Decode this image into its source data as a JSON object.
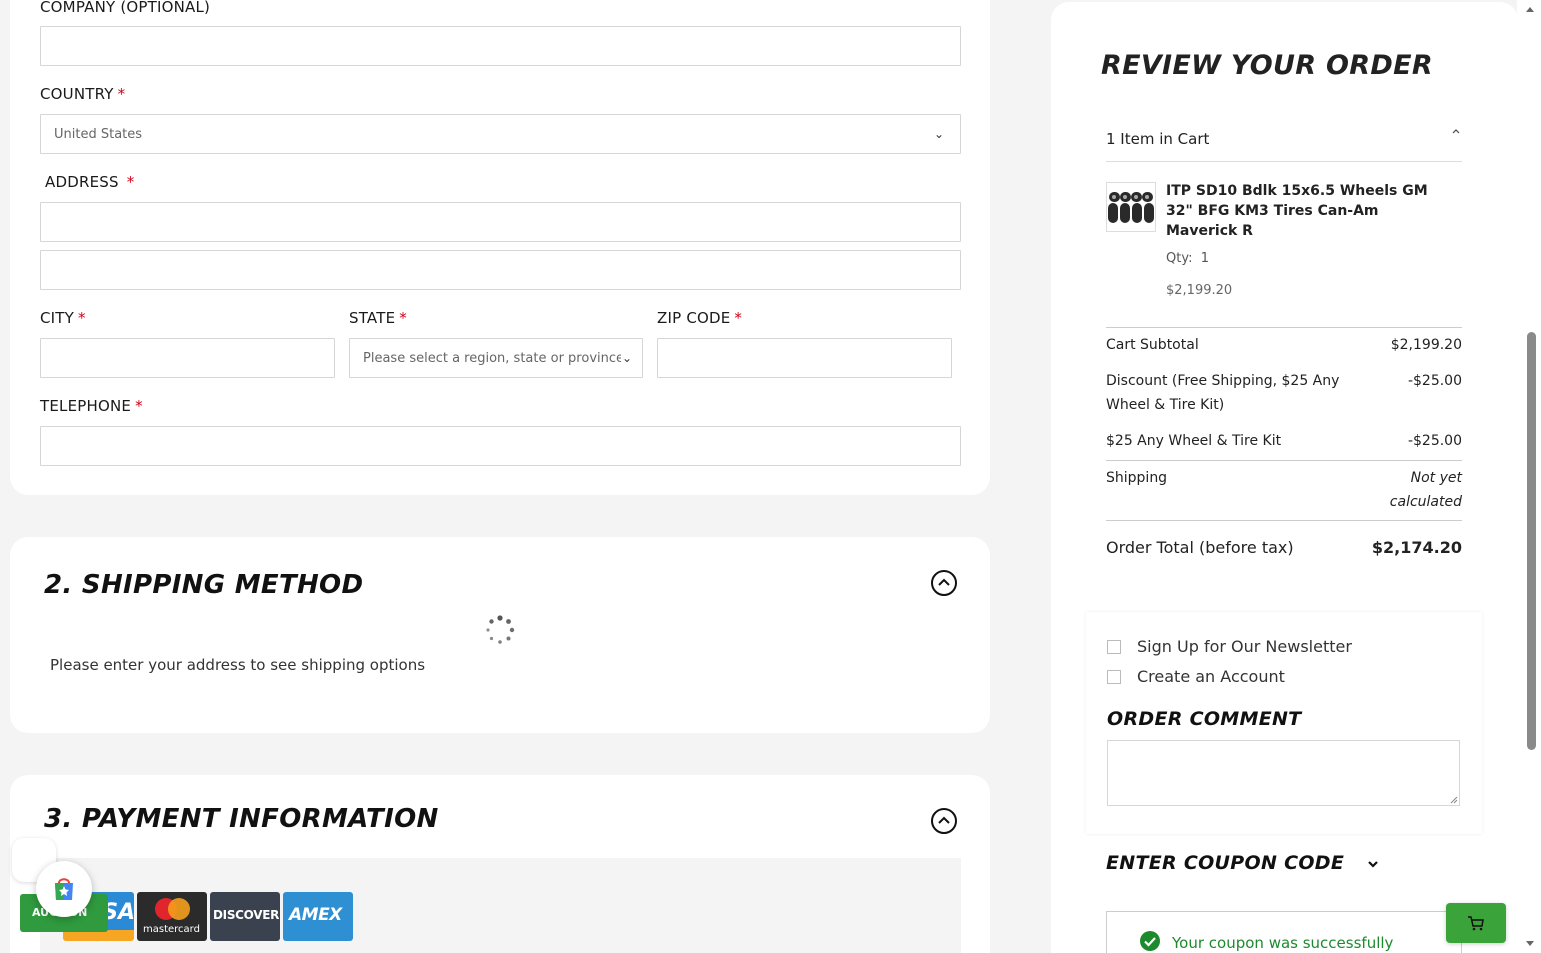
{
  "shipping_form": {
    "company_label": "COMPANY (OPTIONAL)",
    "country_label": "COUNTRY",
    "country_value": "United States",
    "address_label": "ADDRESS",
    "city_label": "CITY",
    "state_label": "STATE",
    "state_placeholder": "Please select a region, state or province.",
    "zip_label": "ZIP CODE",
    "telephone_label": "TELEPHONE",
    "required_mark": "*"
  },
  "shipping_method": {
    "title": "2. SHIPPING METHOD",
    "message": "Please enter your address to see shipping options"
  },
  "payment": {
    "title": "3. PAYMENT INFORMATION",
    "cards": [
      "VISA",
      "mastercard",
      "DISCOVER",
      "AMEX"
    ]
  },
  "order_review": {
    "title": "REVIEW YOUR ORDER",
    "items_in_cart": "1 Item in Cart",
    "item": {
      "name": "ITP SD10 Bdlk 15x6.5 Wheels GM 32\" BFG KM3 Tires Can-Am Maverick R",
      "qty_label": "Qty:",
      "qty": "1",
      "price": "$2,199.20"
    },
    "cart_subtotal_label": "Cart Subtotal",
    "cart_subtotal": "$2,199.20",
    "discount_label": "Discount (Free Shipping, $25 Any Wheel & Tire Kit)",
    "discount_value": "-$25.00",
    "kit_label": "$25 Any Wheel & Tire Kit",
    "kit_value": "-$25.00",
    "shipping_label": "Shipping",
    "shipping_value": "Not yet calculated",
    "total_label": "Order Total (before tax)",
    "total_value": "$2,174.20"
  },
  "options": {
    "newsletter": "Sign Up for Our Newsletter",
    "create_account": "Create an Account",
    "order_comment_title": "ORDER COMMENT",
    "coupon_title": "ENTER COUPON CODE",
    "coupon_success": "Your coupon was successfully"
  },
  "widgets": {
    "auction_label": "AUCTION"
  },
  "colors": {
    "required": "#d0021b",
    "success": "#1e8a2e",
    "cart_button": "#3aa33a"
  }
}
